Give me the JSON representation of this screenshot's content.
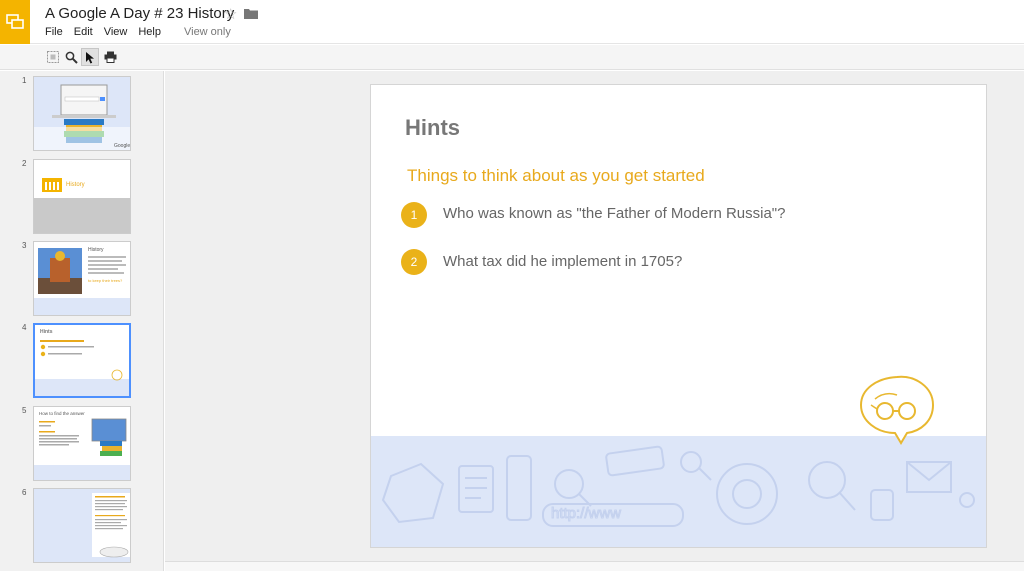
{
  "app": {
    "title": "A Google A Day # 23 History",
    "menu": [
      "File",
      "Edit",
      "View",
      "Help"
    ],
    "view_only": "View only",
    "accent": "#f4b400"
  },
  "toolbar": {
    "tools": [
      "fit-icon",
      "zoom-icon",
      "pointer-icon",
      "print-icon"
    ]
  },
  "slides": [
    {
      "number": "1"
    },
    {
      "number": "2",
      "label": "History"
    },
    {
      "number": "3",
      "label": "History",
      "highlight": "to keep their trees?"
    },
    {
      "number": "4",
      "label": "Hints"
    },
    {
      "number": "5",
      "label": "How to find the answer"
    },
    {
      "number": "6"
    }
  ],
  "current_slide": {
    "title": "Hints",
    "subtitle": "Things to think about as you get started",
    "bullets": [
      {
        "num": "1",
        "text": "Who was known as \"the Father of Modern Russia\"?"
      },
      {
        "num": "2",
        "text": "What tax did he implement in 1705?"
      }
    ],
    "footer_doodle": "http://www",
    "colors": {
      "subtitle": "#e8a91c",
      "bullet": "#eab219",
      "footer": "#dde6f8"
    }
  }
}
